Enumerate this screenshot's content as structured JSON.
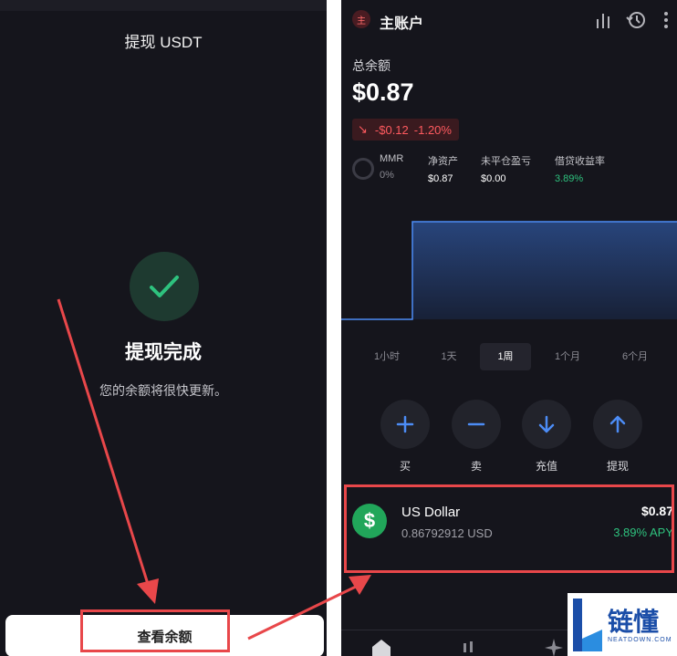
{
  "left_screen": {
    "title": "提现 USDT",
    "success_title": "提现完成",
    "success_subtitle": "您的余额将很快更新。",
    "view_balance_button": "查看余额"
  },
  "right_screen": {
    "account_icon_text": "主",
    "account_name": "主账户",
    "total_label": "总余额",
    "total_value": "$0.87",
    "change_amount": "-$0.12",
    "change_percent": "-1.20%",
    "stats": [
      {
        "label": "MMR",
        "value": "0%"
      },
      {
        "label": "净资产",
        "value": "$0.87"
      },
      {
        "label": "未平仓盈亏",
        "value": "$0.00"
      },
      {
        "label": "借贷收益率",
        "value": "3.89%"
      }
    ],
    "chart_tabs": [
      "1小时",
      "1天",
      "1周",
      "1个月",
      "6个月"
    ],
    "active_tab": "1周",
    "actions": [
      {
        "label": "买",
        "icon": "plus-icon"
      },
      {
        "label": "卖",
        "icon": "minus-icon"
      },
      {
        "label": "充值",
        "icon": "arrow-down-icon"
      },
      {
        "label": "提现",
        "icon": "arrow-up-icon"
      }
    ],
    "asset": {
      "name": "US Dollar",
      "amount": "0.86792912 USD",
      "value": "$0.87",
      "apy": "3.89% APY",
      "icon": "dollar-icon"
    }
  },
  "watermark": {
    "text": "链懂",
    "subtext": "NEATDOWN.COM"
  },
  "colors": {
    "background": "#15151c",
    "positive": "#2ec27e",
    "negative": "#ff5a5f",
    "annotation": "#e8474a",
    "accent": "#4c8cf5"
  }
}
